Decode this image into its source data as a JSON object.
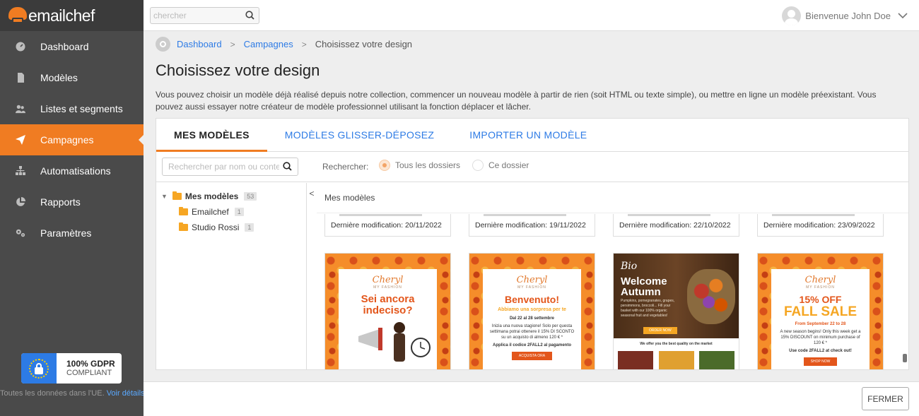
{
  "app": {
    "logo_text": "emailchef"
  },
  "sidebar": {
    "items": [
      {
        "label": "Dashboard",
        "icon": "dashboard-icon",
        "active": false
      },
      {
        "label": "Modèles",
        "icon": "document-icon",
        "active": false
      },
      {
        "label": "Listes et segments",
        "icon": "users-icon",
        "active": false
      },
      {
        "label": "Campagnes",
        "icon": "paper-plane-icon",
        "active": true
      },
      {
        "label": "Automatisations",
        "icon": "sitemap-icon",
        "active": false
      },
      {
        "label": "Rapports",
        "icon": "pie-chart-icon",
        "active": false
      },
      {
        "label": "Paramètres",
        "icon": "gears-icon",
        "active": false
      }
    ],
    "gdpr": {
      "line1": "100% GDPR",
      "line2": "COMPLIANT"
    },
    "eu_note": "Toutes les données dans l'UE.",
    "eu_link": "Voir détails"
  },
  "topbar": {
    "search_placeholder": "chercher",
    "welcome": "Bienvenue John Doe"
  },
  "breadcrumb": {
    "items": [
      "Dashboard",
      "Campagnes",
      "Choisissez votre design"
    ]
  },
  "page": {
    "title": "Choisissez votre design",
    "description": "Vous pouvez choisir un modèle déjà réalisé depuis notre collection, commencer un nouveau modèle à partir de rien (soit HTML ou texte simple), ou mettre en ligne un modèle préexistant. Vous pouvez aussi essayer notre créateur de modèle professionnel utilisant la fonction déplacer et lâcher."
  },
  "tabs": [
    {
      "label": "MES MODÈLES",
      "active": true
    },
    {
      "label": "MODÈLES GLISSER-DÉPOSEZ",
      "active": false
    },
    {
      "label": "IMPORTER UN MODÈLE",
      "active": false
    }
  ],
  "filter": {
    "search_placeholder": "Rechercher par nom ou contenu",
    "label": "Rechercher:",
    "options": [
      {
        "label": "Tous les dossiers",
        "selected": true
      },
      {
        "label": "Ce dossier",
        "selected": false
      }
    ]
  },
  "tree": {
    "root": {
      "label": "Mes modèles",
      "count": "53"
    },
    "children": [
      {
        "label": "Emailchef",
        "count": "1"
      },
      {
        "label": "Studio Rossi",
        "count": "1"
      }
    ]
  },
  "content": {
    "heading": "Mes modèles",
    "meta_cards": [
      "Dernière modification: 20/11/2022",
      "Dernière modification: 19/11/2022",
      "Dernière modification: 22/10/2022",
      "Dernière modification: 23/09/2022"
    ],
    "thumbs": {
      "t1": {
        "logo": "Cheryl",
        "logo_sub": "MY FASHION",
        "title": "Sei ancora indeciso?"
      },
      "t2": {
        "logo": "Cheryl",
        "logo_sub": "MY FASHION",
        "title": "Benvenuto!",
        "subtitle": "Abbiamo una sorpresa per te",
        "dates": "Dal 22 al 28 settembre",
        "body": "Inizia una nuova stagione! Solo per questa settimana potrai ottenere il 15% DI SCONTO su un acquisto di almeno 120 € *",
        "code": "Applica il codice 2FALL2 al pagamento",
        "button": "ACQUISTA ORA"
      },
      "t3": {
        "logo": "Bio",
        "title": "Welcome Autumn",
        "body": "Pumpkins, pomegranates, grapes, persimmons, broccoli... Fill your basket with our 100% organic seasonal fruit and vegetables!",
        "button": "ORDER NOW",
        "sub": "We offer you the best quality on the market"
      },
      "t4": {
        "logo": "Cheryl",
        "logo_sub": "MY FASHION",
        "title": "15% OFF",
        "big": "FALL SALE",
        "dates": "From September 22 to 28",
        "body": "A new season begins! Only this week get a 15% DISCOUNT on minimum purchase of 120 € *",
        "code": "Use code 2FALL2 at check out!",
        "button": "SHOP NOW"
      }
    }
  },
  "footer": {
    "close_label": "FERMER"
  },
  "colors": {
    "accent": "#f07c22",
    "link": "#2d7be5",
    "sidebar": "#4a4a4a"
  }
}
